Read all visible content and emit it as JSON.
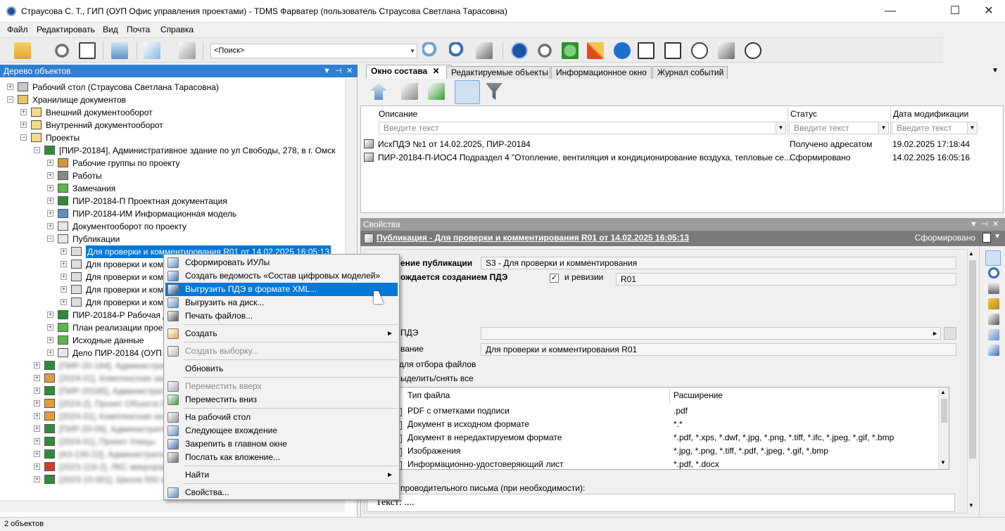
{
  "window": {
    "title": "Страусова С. Т., ГИП (ОУП Офис управления проектами) - TDMS Фарватер (пользователь Страусова Светлана Тарасовна)",
    "minimize": "—",
    "maximize": "☐",
    "close": "✕"
  },
  "menu": {
    "items": [
      "Файл",
      "Редактировать",
      "Вид",
      "Почта",
      "Справка"
    ]
  },
  "toolbar": {
    "search_placeholder": "<Поиск>"
  },
  "tree": {
    "header": "Дерево объектов",
    "nodes": [
      {
        "label": "Рабочий стол (Страусова Светлана Тарасовна)"
      },
      {
        "label": "Хранилище документов"
      },
      {
        "label": "Внешний документооборот"
      },
      {
        "label": "Внутренний документооборот"
      },
      {
        "label": "Проекты"
      },
      {
        "label": "[ПИР-20184], Административное здание по ул Свободы, 278, в г. Омск"
      },
      {
        "label": "Рабочие группы по проекту"
      },
      {
        "label": "Работы"
      },
      {
        "label": "Замечания"
      },
      {
        "label": "ПИР-20184-П Проектная документация"
      },
      {
        "label": "ПИР-20184-ИМ Информационная модель"
      },
      {
        "label": "Документооборот по проекту"
      },
      {
        "label": "Публикации"
      },
      {
        "label": "Для проверки и комментирования R01 от 14.02.2025 16:05:13"
      },
      {
        "label": "Для проверки и ком"
      },
      {
        "label": "Для проверки и ком"
      },
      {
        "label": "Для проверки и ком"
      },
      {
        "label": "Для проверки и ком"
      },
      {
        "label": "ПИР-20184-Р Рабочая д"
      },
      {
        "label": "План реализации прое"
      },
      {
        "label": "Исходные данные"
      },
      {
        "label": "Дело  ПИР-20184 (ОУП"
      },
      {
        "label": "[ПИР-20-184], Административ"
      },
      {
        "label": "[2024-01], Комплексная застр"
      },
      {
        "label": "[ПИР-20185], Административ"
      },
      {
        "label": "[2024-2], Проект Объекта 02"
      },
      {
        "label": "[2024-01], Комплексная застр"
      },
      {
        "label": "[ПИР-20-06], Административ"
      },
      {
        "label": "[2024-01], Проект Улицы"
      },
      {
        "label": "[А3-130-22], Административ"
      },
      {
        "label": "[2023-118-2], ЛКС микрорайон"
      },
      {
        "label": "[2023-10-001], Школа 550 мест"
      }
    ]
  },
  "status": {
    "text": "2 объектов"
  },
  "tabs": [
    {
      "label": "Окно состава",
      "close": "✕"
    },
    {
      "label": "Редактируемые объекты"
    },
    {
      "label": "Информационное окно"
    },
    {
      "label": "Журнал событий"
    }
  ],
  "composition": {
    "columns": [
      "Описание",
      "Статус",
      "Дата модификации"
    ],
    "filter_placeholder": "Введите текст",
    "rows": [
      {
        "desc": "ИсхПДЭ №1 от 14.02.2025, ПИР-20184",
        "status": "Получено адресатом",
        "date": "19.02.2025 17:18:44"
      },
      {
        "desc": "ПИР-20184-П-ИОС4 Подраздел 4 \"Отопление, вентиляция и кондиционирование воздуха, тепловые се...",
        "status": "Сформировано",
        "date": "14.02.2025 16:05:16"
      }
    ]
  },
  "properties": {
    "header": "Свойства",
    "title": "Публикация - Для проверки и комментирования R01 от 14.02.2025 16:05:13",
    "state": "Сформировано",
    "purpose_label": "ение публикации",
    "purpose_value": "S3 - Для проверки и комментирования",
    "accompanied_label": "ождается созданием ПДЭ",
    "revision_label": "и ревизии",
    "revision_value": "R01",
    "pde_label": "ПДЭ",
    "name_label": "вание",
    "name_value": "Для проверки и комментирования R01",
    "file_select_label": "для отбора файлов",
    "select_all_label": "ыделить/снять все",
    "filetypes": {
      "columns": [
        "Тип файла",
        "Расширение"
      ],
      "rows": [
        {
          "type": "PDF с отметками подписи",
          "ext": ".pdf"
        },
        {
          "type": "Документ в исходном формате",
          "ext": "*.*"
        },
        {
          "type": "Документ в нередактируемом формате",
          "ext": "*.pdf, *.xps, *.dwf, *.jpg, *.png, *.tiff, *.ifc,  *.jpeg, *.gif, *.bmp"
        },
        {
          "type": "Изображения",
          "ext": "*.jpg, *.png, *.tiff, *.pdf,  *.jpeg, *.gif, *.bmp"
        },
        {
          "type": "Информационно-удостоверяющий лист",
          "ext": "*.pdf, *.docx"
        }
      ]
    },
    "cover_letter_label": "проводительного письма (при необходимости):",
    "text_label": "Текст: ...."
  },
  "context_menu": {
    "items": [
      {
        "label": "Сформировать ИУЛы"
      },
      {
        "label": "Создать ведомость «Состав цифровых моделей»"
      },
      {
        "label": "Выгрузить ПДЭ в формате XML..."
      },
      {
        "label": "Выгрузить на диск..."
      },
      {
        "label": "Печать файлов..."
      },
      {
        "label": "Создать"
      },
      {
        "label": "Создать выборку..."
      },
      {
        "label": "Обновить"
      },
      {
        "label": "Переместить вверх"
      },
      {
        "label": "Переместить вниз"
      },
      {
        "label": "На рабочий стол"
      },
      {
        "label": "Следующее вхождение"
      },
      {
        "label": "Закрепить в главном окне"
      },
      {
        "label": "Послать как вложение..."
      },
      {
        "label": "Найти"
      },
      {
        "label": "Свойства..."
      }
    ],
    "submenu_arrow": "►"
  },
  "colors": {
    "accent": "#0078d7",
    "panel_header": "#2f7fd3",
    "props_title": "#7a7a7a"
  }
}
